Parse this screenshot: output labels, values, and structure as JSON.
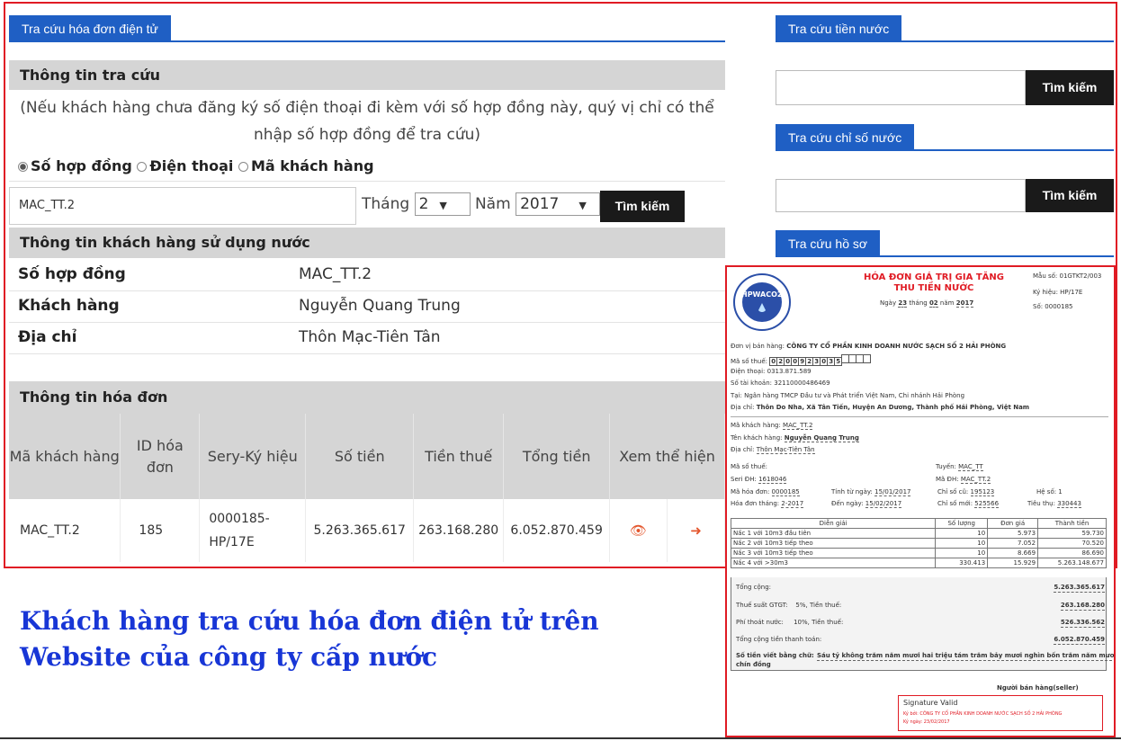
{
  "left": {
    "tab": "Tra cứu hóa đơn điện tử",
    "lookup_head": "Thông tin tra cứu",
    "note": "(Nếu khách hàng chưa đăng ký số điện thoại đi kèm với số hợp đồng này, quý vị chỉ có thể nhập số hợp đồng để tra cứu)",
    "radios": [
      "Số hợp đồng",
      "Điện thoại",
      "Mã khách hàng"
    ],
    "input_value": "MAC_TT.2",
    "month_label": "Tháng",
    "month_value": "2",
    "year_label": "Năm",
    "year_value": "2017",
    "search_button": "Tìm kiếm",
    "customer_head": "Thông tin khách hàng sử dụng nước",
    "customer": [
      {
        "label": "Số hợp đồng",
        "value": "MAC_TT.2"
      },
      {
        "label": "Khách hàng",
        "value": "Nguyễn Quang Trung"
      },
      {
        "label": "Địa chỉ",
        "value": "Thôn Mạc-Tiên Tân"
      }
    ],
    "invoice_head": "Thông tin hóa đơn",
    "table_headers": [
      "Mã khách hàng",
      "ID hóa đơn",
      "Sery-Ký hiệu",
      "Số tiền",
      "Tiền thuế",
      "Tổng tiền",
      "Xem thể hiện"
    ],
    "table_row": [
      "MAC_TT.2",
      "185",
      "0000185-HP/17E",
      "5.263.365.617",
      "263.168.280",
      "6.052.870.459"
    ]
  },
  "right": {
    "water_tab": "Tra cứu tiền nước",
    "index_tab": "Tra cứu chỉ số nước",
    "profile_tab": "Tra cứu hồ sơ",
    "search_button": "Tìm kiếm"
  },
  "caption": [
    "Khách hàng tra cứu hóa đơn điện tử trên",
    "Website của công ty cấp nước"
  ],
  "invoice": {
    "logo_text": "HPWACO2",
    "title1": "HÓA ĐƠN GIÁ TRỊ GIA TĂNG",
    "title2": "THU TIỀN NƯỚC",
    "date_line": {
      "ngay_label": "Ngày",
      "ngay": "23",
      "thang_label": "tháng",
      "thang": "02",
      "nam_label": "năm",
      "nam": "2017"
    },
    "mau_so": "Mẫu số: 01GTKT2/003",
    "ky_hieu": "Ký hiệu: HP/17E",
    "so": "Số: 0000185",
    "seller_label": "Đơn vị bán hàng:",
    "seller": "CÔNG TY CỔ PHẦN KINH DOANH NƯỚC SẠCH SỐ 2 HẢI PHÒNG",
    "tax_label": "Mã số thuế:",
    "tax_digits": [
      "0",
      "2",
      "0",
      "0",
      "9",
      "2",
      "3",
      "0",
      "3",
      "5",
      "",
      "",
      "",
      ""
    ],
    "phone": "Điện thoại: 0313.871.589",
    "account": "Số tài khoản: 32110000486469",
    "bank": "Tại: Ngân hàng TMCP Đầu tư và Phát triển Việt Nam, Chi nhánh Hải Phòng",
    "address_label": "Địa chỉ:",
    "address": "Thôn Do Nha, Xã Tân Tiến, Huyện An Dương, Thành phố Hải Phòng, Việt Nam",
    "ma_kh_label": "Mã khách hàng:",
    "ma_kh": "MAC_TT.2",
    "ten_kh_label": "Tên khách hàng:",
    "ten_kh": "Nguyễn Quang Trung",
    "dia_chi_label": "Địa chỉ:",
    "dia_chi": "Thôn Mạc-Tiên Tân",
    "mst_label": "Mã số thuế:",
    "tuyen_label": "Tuyến:",
    "tuyen": "MAC_TT",
    "seri_label": "Seri ĐH:",
    "seri": "1618046",
    "ma_dh_label": "Mã ĐH:",
    "ma_dh": "MAC_TT.2",
    "ma_hd_label": "Mã hóa đơn:",
    "ma_hd": "0000185",
    "tinh_tu_label": "Tính từ ngày:",
    "tinh_tu": "15/01/2017",
    "chi_so_cu_label": "Chỉ số cũ:",
    "chi_so_cu": "195123",
    "he_so": "Hệ số: 1",
    "hd_thang_label": "Hóa đơn tháng:",
    "hd_thang": "2-2017",
    "den_ngay_label": "Đến ngày:",
    "den_ngay": "15/02/2017",
    "chi_so_moi_label": "Chỉ số mới:",
    "chi_so_moi": "525566",
    "tieu_thu_label": "Tiêu thụ:",
    "tieu_thu": "330443",
    "table_headers": [
      "Diễn giải",
      "Số lượng",
      "Đơn giá",
      "Thành tiền"
    ],
    "table_rows": [
      [
        "Nấc 1 với 10m3 đầu tiên",
        "10",
        "5.973",
        "59.730"
      ],
      [
        "Nấc 2 với 10m3 tiếp theo",
        "10",
        "7.052",
        "70.520"
      ],
      [
        "Nấc 3 với 10m3 tiếp theo",
        "10",
        "8.669",
        "86.690"
      ],
      [
        "Nấc 4 với >30m3",
        "330.413",
        "15.929",
        "5.263.148.677"
      ]
    ],
    "tong_cong_label": "Tổng cộng:",
    "tong_cong": "5.263.365.617",
    "thue_label": "Thuế suất GTGT:",
    "thue_rate": "5%,",
    "tien_thue_label": "Tiền thuế:",
    "tien_thue": "263.168.280",
    "phi_label": "Phí thoát nước:",
    "phi_rate": "10%,",
    "tien_phi_label": "Tiền thuế:",
    "tien_phi": "526.336.562",
    "tong_tt_label": "Tổng cộng tiền thanh toán:",
    "tong_tt": "6.052.870.459",
    "bang_chu_label": "Số tiền viết bằng chữ:",
    "bang_chu_1": "Sáu tỷ không trăm năm mươi hai triệu tám trăm bảy mươi nghìn bốn trăm năm mươi",
    "bang_chu_2": "chín đồng",
    "nguoi_ban": "Người bán hàng(seller)",
    "sig_valid": "Signature Valid",
    "sig_by": "Ký bởi: CÔNG TY CỔ PHẦN KINH DOANH NƯỚC SẠCH SỐ 2 HẢI PHÒNG",
    "sig_date": "Ký ngày: 23/02/2017"
  }
}
